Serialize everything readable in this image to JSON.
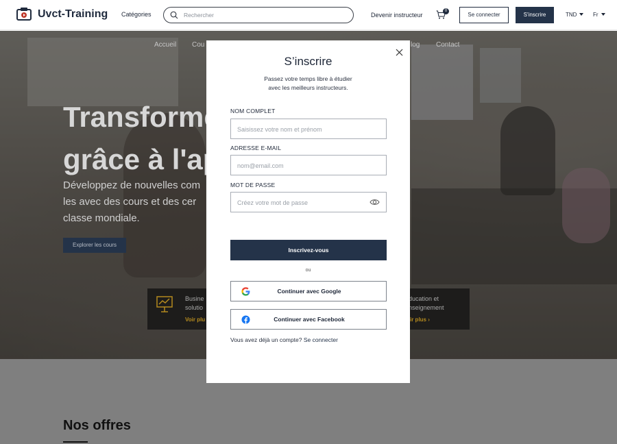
{
  "header": {
    "brand": "Uvct-Training",
    "categories_label": "Catégories",
    "search_placeholder": "Rechercher",
    "become_instructor": "Devenir instructeur",
    "cart_count": "0",
    "login_label": "Se connecter",
    "signup_label": "S'inscrire",
    "currency": "TND",
    "language": "Fr"
  },
  "hero": {
    "nav": [
      "Accueil",
      "Cou",
      "log",
      "Contact"
    ],
    "title_line1": "Transforme",
    "title_line2": "grâce à l'ap",
    "subtitle_line1": "Développez de nouvelles com",
    "subtitle_line2": "les avec des cours et des cer",
    "subtitle_line3": "classe mondiale.",
    "cta": "Explorer les cours",
    "card_a": {
      "line1": "Busine",
      "line2": "solutio",
      "link": "Voir plu"
    },
    "card_b": {
      "line1": "ducation et",
      "line2": "nseignement",
      "link": "ir plus"
    }
  },
  "section": {
    "offers_title": "Nos offres"
  },
  "modal": {
    "title": "S’inscrire",
    "subtitle_line1": "Passez votre temps libre à étudier",
    "subtitle_line2": "avec les meilleurs instructeurs.",
    "name_label": "NOM  COMPLET",
    "name_placeholder": "Saisissez votre nom et prénom",
    "email_label": "ADRESSE E-MAIL",
    "email_placeholder": "nom@email.com",
    "password_label": "MOT DE PASSE",
    "password_placeholder": "Créez votre mot de passe",
    "submit_label": "Inscrivez-vous",
    "or_label": "ou",
    "google_label": "Continuer avec Google",
    "facebook_label": "Continuer avec Facebook",
    "footer_text": "Vous avez déjà un compte?",
    "footer_link": "Se connecter"
  },
  "icons": {
    "logo": "logo-icon",
    "search": "search-icon",
    "cart": "cart-icon",
    "caret": "chevron-down-icon",
    "close": "close-icon",
    "eye": "eye-icon",
    "google": "google-icon",
    "facebook": "facebook-icon",
    "presentation": "presentation-chart-icon"
  },
  "colors": {
    "primary": "#243349",
    "link_gold": "#b48a1e",
    "facebook_blue": "#1877f2"
  }
}
